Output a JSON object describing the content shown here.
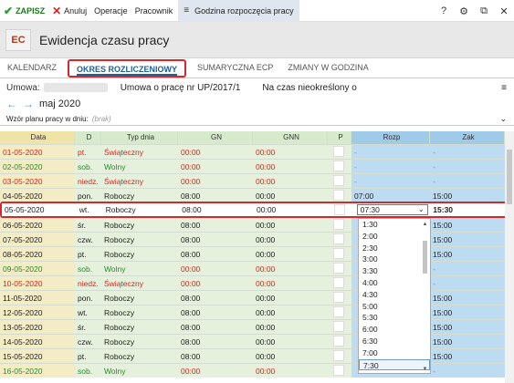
{
  "toolbar": {
    "save_label": "ZAPISZ",
    "cancel_label": "Anuluj",
    "operations_label": "Operacje",
    "employee_label": "Pracownik",
    "active_label": "Godzina rozpoczęcia pracy",
    "help_symbol": "?",
    "settings_symbol": "⚙",
    "window_symbol": "⧉",
    "close_symbol": "✕"
  },
  "header": {
    "badge": "EC",
    "title": "Ewidencja czasu pracy"
  },
  "tabs": [
    {
      "label": "KALENDARZ",
      "active": false
    },
    {
      "label": "OKRES ROZLICZENIOWY",
      "active": true
    },
    {
      "label": "SUMARYCZNA ECP",
      "active": false
    },
    {
      "label": "ZMIANY W GODZINA",
      "active": false
    }
  ],
  "contract": {
    "label": "Umowa:",
    "type": "Umowa o pracę nr UP/2017/1",
    "period": "Na czas nieokreślony o"
  },
  "period": {
    "month": "maj 2020",
    "prev_symbol": "←",
    "next_symbol": "→"
  },
  "pattern": {
    "label": "Wzór planu pracy w dniu:",
    "value": "(brak)"
  },
  "table": {
    "headers": [
      "Data",
      "D",
      "Typ dnia",
      "GN",
      "GNN",
      "P",
      "Rozp",
      "Zak"
    ],
    "rows": [
      {
        "date": "01-05-2020",
        "day": "pt.",
        "type": "Świąteczny",
        "gn": "00:00",
        "gnn": "00:00",
        "rozp": "-",
        "zak": "-",
        "color": "red"
      },
      {
        "date": "02-05-2020",
        "day": "sob.",
        "type": "Wolny",
        "gn": "00:00",
        "gnn": "00:00",
        "rozp": "-",
        "zak": "-",
        "color": "green"
      },
      {
        "date": "03-05-2020",
        "day": "niedz.",
        "type": "Świąteczny",
        "gn": "00:00",
        "gnn": "00:00",
        "rozp": "-",
        "zak": "-",
        "color": "red"
      },
      {
        "date": "04-05-2020",
        "day": "pon.",
        "type": "Roboczy",
        "gn": "08:00",
        "gnn": "00:00",
        "rozp": "07:00",
        "zak": "15:00",
        "color": "normal"
      },
      {
        "date": "05-05-2020",
        "day": "wt.",
        "type": "Roboczy",
        "gn": "08:00",
        "gnn": "00:00",
        "rozp": "07:30",
        "zak": "15:30",
        "color": "normal"
      },
      {
        "date": "06-05-2020",
        "day": "śr.",
        "type": "Roboczy",
        "gn": "08:00",
        "gnn": "00:00",
        "rozp": "",
        "zak": "15:00",
        "color": "normal"
      },
      {
        "date": "07-05-2020",
        "day": "czw.",
        "type": "Roboczy",
        "gn": "08:00",
        "gnn": "00:00",
        "rozp": "",
        "zak": "15:00",
        "color": "normal"
      },
      {
        "date": "08-05-2020",
        "day": "pt.",
        "type": "Roboczy",
        "gn": "08:00",
        "gnn": "00:00",
        "rozp": "",
        "zak": "15:00",
        "color": "normal"
      },
      {
        "date": "09-05-2020",
        "day": "sob.",
        "type": "Wolny",
        "gn": "00:00",
        "gnn": "00:00",
        "rozp": "",
        "zak": "-",
        "color": "green"
      },
      {
        "date": "10-05-2020",
        "day": "niedz.",
        "type": "Świąteczny",
        "gn": "00:00",
        "gnn": "00:00",
        "rozp": "",
        "zak": "-",
        "color": "red"
      },
      {
        "date": "11-05-2020",
        "day": "pon.",
        "type": "Roboczy",
        "gn": "08:00",
        "gnn": "00:00",
        "rozp": "",
        "zak": "15:00",
        "color": "normal"
      },
      {
        "date": "12-05-2020",
        "day": "wt.",
        "type": "Roboczy",
        "gn": "08:00",
        "gnn": "00:00",
        "rozp": "",
        "zak": "15:00",
        "color": "normal"
      },
      {
        "date": "13-05-2020",
        "day": "śr.",
        "type": "Roboczy",
        "gn": "08:00",
        "gnn": "00:00",
        "rozp": "",
        "zak": "15:00",
        "color": "normal"
      },
      {
        "date": "14-05-2020",
        "day": "czw.",
        "type": "Roboczy",
        "gn": "08:00",
        "gnn": "00:00",
        "rozp": "",
        "zak": "15:00",
        "color": "normal"
      },
      {
        "date": "15-05-2020",
        "day": "pt.",
        "type": "Roboczy",
        "gn": "08:00",
        "gnn": "00:00",
        "rozp": "",
        "zak": "15:00",
        "color": "normal"
      },
      {
        "date": "16-05-2020",
        "day": "sob.",
        "type": "Wolny",
        "gn": "00:00",
        "gnn": "00:00",
        "rozp": "",
        "zak": "-",
        "color": "green"
      }
    ]
  },
  "rozp_dropdown": {
    "current": "07:30",
    "chevron": "⌄",
    "options": [
      "1:30",
      "2:00",
      "2:30",
      "3:00",
      "3:30",
      "4:00",
      "4:30",
      "5:00",
      "5:30",
      "6:00",
      "6:30",
      "7:00",
      "7:30"
    ],
    "selected": "7:30"
  },
  "menu_symbol": "≡",
  "wzor_chevron": "⌄"
}
